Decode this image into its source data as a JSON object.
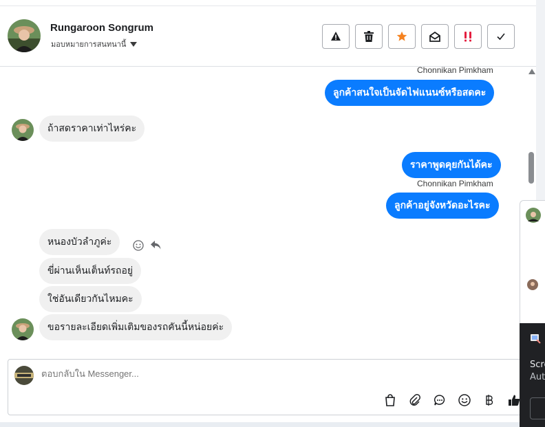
{
  "header": {
    "contact_name": "Rungaroon Songrum",
    "assignment_label": "มอบหมายการสนทนานี้",
    "toolbar": [
      {
        "name": "report-button",
        "icon": "warning-icon"
      },
      {
        "name": "delete-button",
        "icon": "trash-icon"
      },
      {
        "name": "star-button",
        "icon": "star-icon",
        "color": "#f5821f"
      },
      {
        "name": "mark-unread-button",
        "icon": "envelope-open-icon"
      },
      {
        "name": "spam-button",
        "icon": "double-exclamation-icon",
        "color": "#e41e3f"
      },
      {
        "name": "done-button",
        "icon": "check-icon"
      }
    ]
  },
  "messages": [
    {
      "from": "agent",
      "sender": "Chonnikan Pimkham",
      "text": "ลูกค้าสนใจเป็นจัดไฟแนนซ์หรือสดคะ"
    },
    {
      "from": "customer",
      "text": "ถ้าสดราคาเท่าไหร่คะ"
    },
    {
      "from": "agent",
      "text": "ราคาพูดคุยกันได้คะ"
    },
    {
      "from": "agent",
      "sender": "Chonnikan Pimkham",
      "text": "ลูกค้าอยู่จังหวัดอะไรคะ"
    },
    {
      "from": "customer",
      "text": "หนองบัวลำภูค่ะ"
    },
    {
      "from": "customer",
      "text": "ขี่ผ่านเห็นเต็นท์รถอยู่"
    },
    {
      "from": "customer",
      "text": "ใช่อันเดียวกันไหมคะ"
    },
    {
      "from": "customer",
      "text": "ขอรายละเอียดเพิ่มเติมของรถคันนี้หน่อยค่ะ"
    }
  ],
  "composer": {
    "placeholder": "ตอบกลับใน Messenger...",
    "tools": [
      "shopping-bag-icon",
      "paperclip-icon",
      "saved-reply-icon",
      "emoji-icon",
      "baht-icon",
      "thumbs-up-icon"
    ]
  },
  "side_panel": {
    "line1": "Scre",
    "line2": "Aut"
  },
  "colors": {
    "outgoing_bubble": "#0a7cff",
    "incoming_bubble": "#f0f0f0",
    "star": "#f5821f",
    "spam": "#e41e3f"
  }
}
